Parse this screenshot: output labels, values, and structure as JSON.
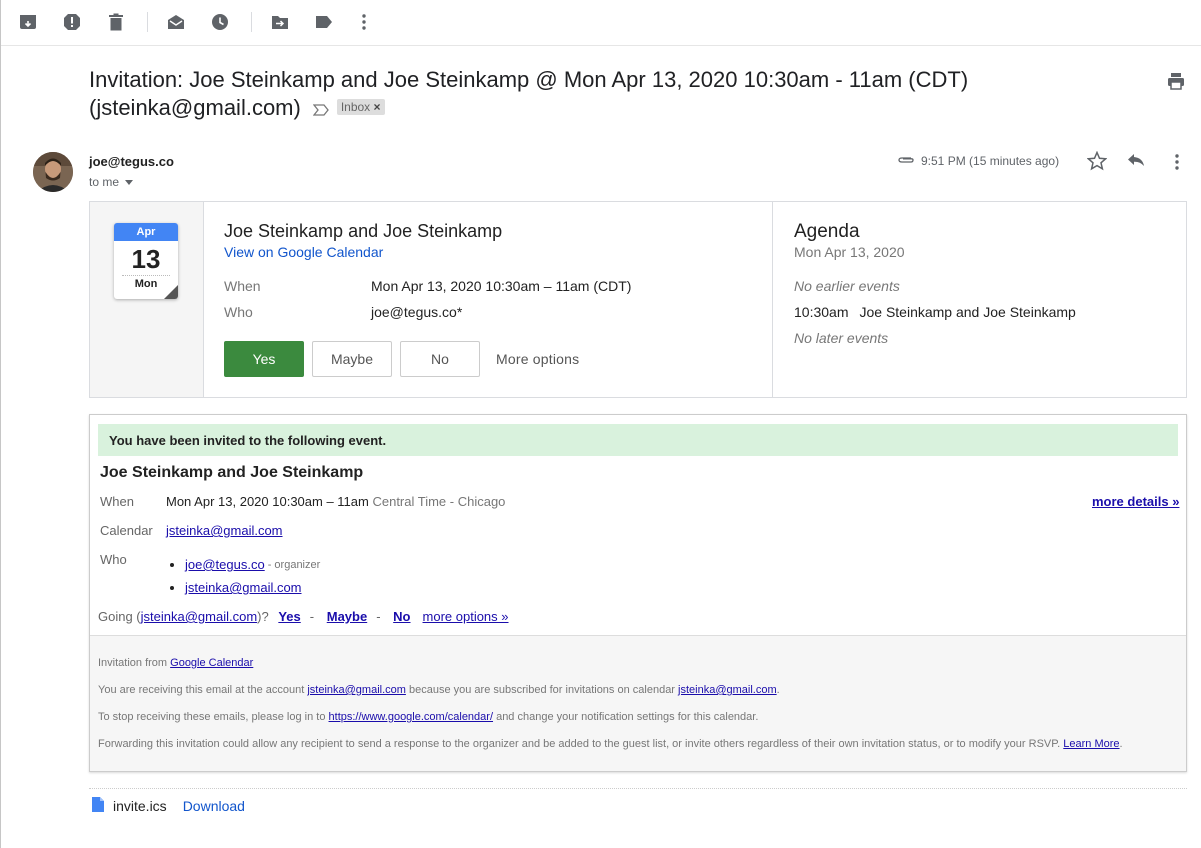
{
  "toolbar": {
    "icons": [
      "archive-icon",
      "report-spam-icon",
      "delete-icon",
      "mark-unread-icon",
      "snooze-icon",
      "move-to-icon",
      "labels-icon",
      "more-vert-icon"
    ]
  },
  "subject": {
    "text": "Invitation: Joe Steinkamp and Joe Steinkamp @ Mon Apr 13, 2020 10:30am - 11am (CDT) (jsteinka@gmail.com)",
    "label_chip": "Inbox",
    "chip_close": "×"
  },
  "message": {
    "sender": "joe@tegus.co",
    "recipient": "to me",
    "time": "9:51 PM (15 minutes ago)"
  },
  "calendar_card": {
    "month": "Apr",
    "day": "13",
    "weekday": "Mon",
    "event_title": "Joe Steinkamp and Joe Steinkamp",
    "view_link": "View on Google Calendar",
    "when_label": "When",
    "when_value": "Mon Apr 13, 2020 10:30am – 11am (CDT)",
    "who_label": "Who",
    "who_value": "joe@tegus.co*",
    "buttons": {
      "yes": "Yes",
      "maybe": "Maybe",
      "no": "No",
      "more": "More options"
    },
    "colors": {
      "yes_bg": "#3b8a3e",
      "cal_header": "#4285f4"
    }
  },
  "agenda": {
    "title": "Agenda",
    "date": "Mon Apr 13, 2020",
    "no_earlier": "No earlier events",
    "event_time": "10:30am",
    "event_title": "Joe Steinkamp and Joe Steinkamp",
    "no_later": "No later events"
  },
  "invitation": {
    "banner": "You have been invited to the following event.",
    "title": "Joe Steinkamp and Joe Steinkamp",
    "when_label": "When",
    "when_value": "Mon Apr 13, 2020 10:30am – 11am",
    "when_tz": "Central Time - Chicago",
    "more_details": "more details »",
    "calendar_label": "Calendar",
    "calendar_value": "jsteinka@gmail.com",
    "who_label": "Who",
    "guests": [
      {
        "email": "joe@tegus.co",
        "role": "- organizer"
      },
      {
        "email": "jsteinka@gmail.com",
        "role": ""
      }
    ],
    "going_prefix": "Going (",
    "going_email": "jsteinka@gmail.com",
    "going_suffix": ")?",
    "going_yes": "Yes",
    "going_maybe": "Maybe",
    "going_no": "No",
    "going_sep": "-",
    "going_more": "more options »",
    "banner_color": "#d9f2dd"
  },
  "footer": {
    "line1_prefix": "Invitation from ",
    "line1_link": "Google Calendar",
    "line2_a": "You are receiving this email at the account ",
    "line2_link1": "jsteinka@gmail.com",
    "line2_b": " because you are subscribed for invitations on calendar ",
    "line2_link2": "jsteinka@gmail.com",
    "line2_c": ".",
    "line3_a": "To stop receiving these emails, please log in to ",
    "line3_link": "https://www.google.com/calendar/",
    "line3_b": " and change your notification settings for this calendar.",
    "line4_a": "Forwarding this invitation could allow any recipient to send a response to the organizer and be added to the guest list, or invite others regardless of their own invitation status, or to modify your RSVP. ",
    "line4_link": "Learn More",
    "line4_b": "."
  },
  "attachment": {
    "filename": "invite.ics",
    "download": "Download",
    "icon": "file-icon"
  }
}
